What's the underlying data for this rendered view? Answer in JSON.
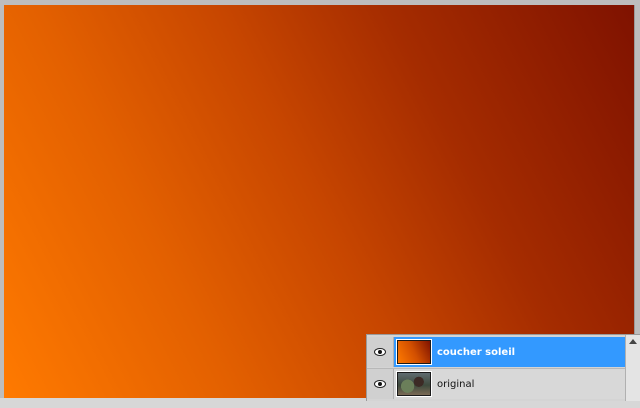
{
  "canvas": {
    "gradient_colors": [
      "#ff7a00",
      "#e36000",
      "#c74600",
      "#a52c00",
      "#7f1200"
    ]
  },
  "layers_panel": {
    "selection_color": "#3399ff",
    "layers": [
      {
        "name": "coucher soleil",
        "visible_icon": "eye-icon",
        "selected": true,
        "thumbnail": "gradient-thumbnail"
      },
      {
        "name": "original",
        "visible_icon": "eye-icon",
        "selected": false,
        "thumbnail": "photo-thumbnail"
      }
    ]
  }
}
